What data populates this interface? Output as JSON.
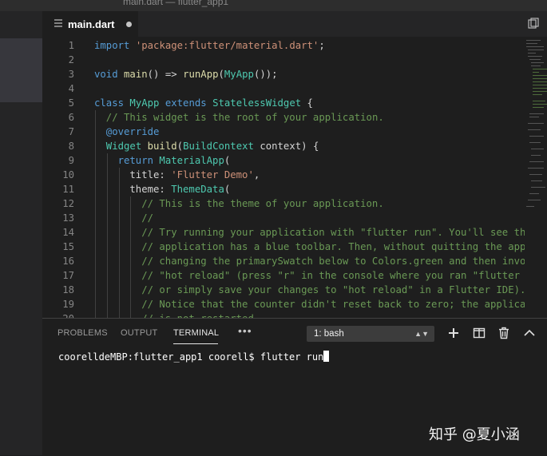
{
  "window": {
    "title": "main.dart — flutter_app1"
  },
  "tab": {
    "file_name": "main.dart",
    "icon": "list-file-icon",
    "unsaved": true
  },
  "editor": {
    "lines": [
      {
        "n": "1",
        "indent": 0,
        "tokens": [
          {
            "t": "import ",
            "c": "kw"
          },
          {
            "t": "'package:flutter/material.dart'",
            "c": "str"
          },
          {
            "t": ";",
            "c": "p"
          }
        ]
      },
      {
        "n": "2",
        "indent": 0,
        "tokens": []
      },
      {
        "n": "3",
        "indent": 0,
        "tokens": [
          {
            "t": "void ",
            "c": "kw"
          },
          {
            "t": "main",
            "c": "fn"
          },
          {
            "t": "() => ",
            "c": "p"
          },
          {
            "t": "runApp",
            "c": "fn"
          },
          {
            "t": "(",
            "c": "p"
          },
          {
            "t": "MyApp",
            "c": "ty"
          },
          {
            "t": "());",
            "c": "p"
          }
        ]
      },
      {
        "n": "4",
        "indent": 0,
        "tokens": []
      },
      {
        "n": "5",
        "indent": 0,
        "tokens": [
          {
            "t": "class ",
            "c": "kw"
          },
          {
            "t": "MyApp ",
            "c": "ty"
          },
          {
            "t": "extends ",
            "c": "kw"
          },
          {
            "t": "StatelessWidget",
            "c": "ty"
          },
          {
            "t": " {",
            "c": "p"
          }
        ]
      },
      {
        "n": "6",
        "indent": 1,
        "tokens": [
          {
            "t": "// This widget is the root of your application.",
            "c": "cm"
          }
        ]
      },
      {
        "n": "7",
        "indent": 1,
        "tokens": [
          {
            "t": "@override",
            "c": "an"
          }
        ]
      },
      {
        "n": "8",
        "indent": 1,
        "tokens": [
          {
            "t": "Widget ",
            "c": "ty"
          },
          {
            "t": "build",
            "c": "fn"
          },
          {
            "t": "(",
            "c": "p"
          },
          {
            "t": "BuildContext ",
            "c": "ty"
          },
          {
            "t": "context) {",
            "c": "p"
          }
        ]
      },
      {
        "n": "9",
        "indent": 2,
        "tokens": [
          {
            "t": "return ",
            "c": "kw"
          },
          {
            "t": "MaterialApp",
            "c": "ty"
          },
          {
            "t": "(",
            "c": "p"
          }
        ]
      },
      {
        "n": "10",
        "indent": 3,
        "tokens": [
          {
            "t": "title: ",
            "c": "p"
          },
          {
            "t": "'Flutter Demo'",
            "c": "str"
          },
          {
            "t": ",",
            "c": "p"
          }
        ]
      },
      {
        "n": "11",
        "indent": 3,
        "tokens": [
          {
            "t": "theme: ",
            "c": "p"
          },
          {
            "t": "ThemeData",
            "c": "ty"
          },
          {
            "t": "(",
            "c": "p"
          }
        ]
      },
      {
        "n": "12",
        "indent": 4,
        "tokens": [
          {
            "t": "// This is the theme of your application.",
            "c": "cm"
          }
        ]
      },
      {
        "n": "13",
        "indent": 4,
        "tokens": [
          {
            "t": "//",
            "c": "cm"
          }
        ]
      },
      {
        "n": "14",
        "indent": 4,
        "tokens": [
          {
            "t": "// Try running your application with \"flutter run\". You'll see the",
            "c": "cm"
          }
        ]
      },
      {
        "n": "15",
        "indent": 4,
        "tokens": [
          {
            "t": "// application has a blue toolbar. Then, without quitting the app,",
            "c": "cm"
          }
        ]
      },
      {
        "n": "16",
        "indent": 4,
        "tokens": [
          {
            "t": "// changing the primarySwatch below to Colors.green and then invoke",
            "c": "cm"
          }
        ]
      },
      {
        "n": "17",
        "indent": 4,
        "tokens": [
          {
            "t": "// \"hot reload\" (press \"r\" in the console where you ran \"flutter ru",
            "c": "cm"
          }
        ]
      },
      {
        "n": "18",
        "indent": 4,
        "tokens": [
          {
            "t": "// or simply save your changes to \"hot reload\" in a Flutter IDE).",
            "c": "cm"
          }
        ]
      },
      {
        "n": "19",
        "indent": 4,
        "tokens": [
          {
            "t": "// Notice that the counter didn't reset back to zero; the applicati",
            "c": "cm"
          }
        ]
      },
      {
        "n": "20",
        "indent": 4,
        "tokens": [
          {
            "t": "// is not restarted.",
            "c": "cm"
          }
        ]
      }
    ]
  },
  "panel": {
    "tabs": [
      {
        "label": "PROBLEMS",
        "active": false
      },
      {
        "label": "OUTPUT",
        "active": false
      },
      {
        "label": "TERMINAL",
        "active": true
      }
    ],
    "more_label": "•••",
    "shell_select": "1: bash",
    "actions": [
      "plus-icon",
      "split-terminal-icon",
      "trash-icon",
      "chevron-up-icon"
    ]
  },
  "terminal": {
    "prompt": "coorelldeMBP:flutter_app1 coorell$ ",
    "command": "flutter run"
  },
  "watermark": {
    "text": "知乎 @夏小涵"
  },
  "colors": {
    "background": "#1e1e1e",
    "sidebar": "#252526",
    "keyword": "#569cd6",
    "string": "#ce9178",
    "function": "#dcdcaa",
    "type": "#4ec9b0",
    "comment": "#6a9955"
  }
}
